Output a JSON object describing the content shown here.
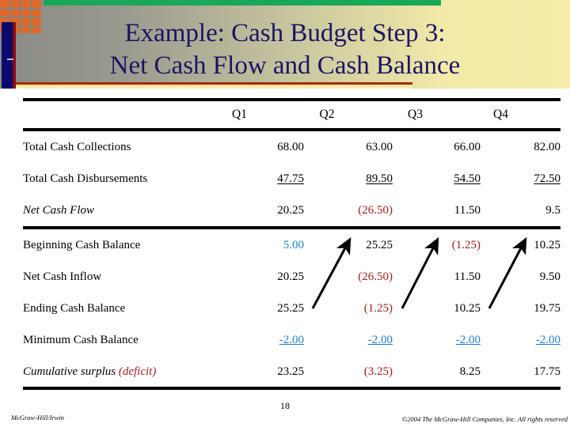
{
  "slide": {
    "title": "Example: Cash Budget Step 3:\nNet Cash Flow and Cash Balance",
    "number": "18",
    "footer_left": "McGraw-Hill/Irwin",
    "footer_right": "©2004 The McGraw-Hill Companies, Inc. All rights reserved"
  },
  "colors": {
    "title_navy": "#1b1464",
    "green_bar": "#19a85a",
    "orange_block": "#e06a2a",
    "left_navy": "#0a0a6e",
    "left_red": "#8a0b12",
    "negative_red": "#a02020",
    "highlight_blue": "#1f7fc4",
    "rule_black": "#000000"
  },
  "table": {
    "columns": [
      "Q1",
      "Q2",
      "Q3",
      "Q4"
    ],
    "rows": [
      {
        "label": "Total Cash Collections",
        "label_style": "normal",
        "values": [
          "68.00",
          "63.00",
          "66.00",
          "82.00"
        ],
        "value_styles": [
          "normal",
          "normal",
          "normal",
          "normal"
        ]
      },
      {
        "label": "Total Cash Disbursements",
        "label_style": "normal",
        "values": [
          "47.75",
          "89.50",
          "54.50",
          "72.50"
        ],
        "value_styles": [
          "underline",
          "underline",
          "underline",
          "underline"
        ]
      },
      {
        "label": "Net Cash Flow",
        "label_style": "italic",
        "values": [
          "20.25",
          "(26.50)",
          "11.50",
          "9.5"
        ],
        "value_styles": [
          "normal",
          "negative",
          "normal",
          "normal"
        ]
      },
      {
        "label": "Beginning Cash Balance",
        "label_style": "normal",
        "values": [
          "5.00",
          "25.25",
          "(1.25)",
          "10.25"
        ],
        "value_styles": [
          "blue",
          "normal",
          "negative",
          "normal"
        ]
      },
      {
        "label": "Net Cash Inflow",
        "label_style": "normal",
        "values": [
          "20.25",
          "(26.50)",
          "11.50",
          "9.50"
        ],
        "value_styles": [
          "normal",
          "negative",
          "normal",
          "normal"
        ]
      },
      {
        "label": "Ending Cash Balance",
        "label_style": "normal",
        "values": [
          "25.25",
          "(1.25)",
          "10.25",
          "19.75"
        ],
        "value_styles": [
          "normal",
          "negative",
          "normal",
          "normal"
        ]
      },
      {
        "label": "Minimum Cash Balance",
        "label_style": "normal",
        "values": [
          "-2.00",
          "-2.00",
          "-2.00",
          "-2.00"
        ],
        "value_styles": [
          "blue-underline",
          "blue-underline",
          "blue-underline",
          "blue-underline"
        ]
      },
      {
        "label": "Cumulative surplus ",
        "label_suffix": "(deficit)",
        "label_style": "italic",
        "values": [
          "23.25",
          "(3.25)",
          "8.25",
          "17.75"
        ],
        "value_styles": [
          "normal",
          "negative",
          "normal",
          "normal"
        ]
      }
    ]
  },
  "annotations": {
    "arrows": [
      {
        "name": "arrow-q1-ending-to-q2-beginning"
      },
      {
        "name": "arrow-q2-ending-to-q3-beginning"
      },
      {
        "name": "arrow-q3-ending-to-q4-beginning"
      }
    ]
  }
}
